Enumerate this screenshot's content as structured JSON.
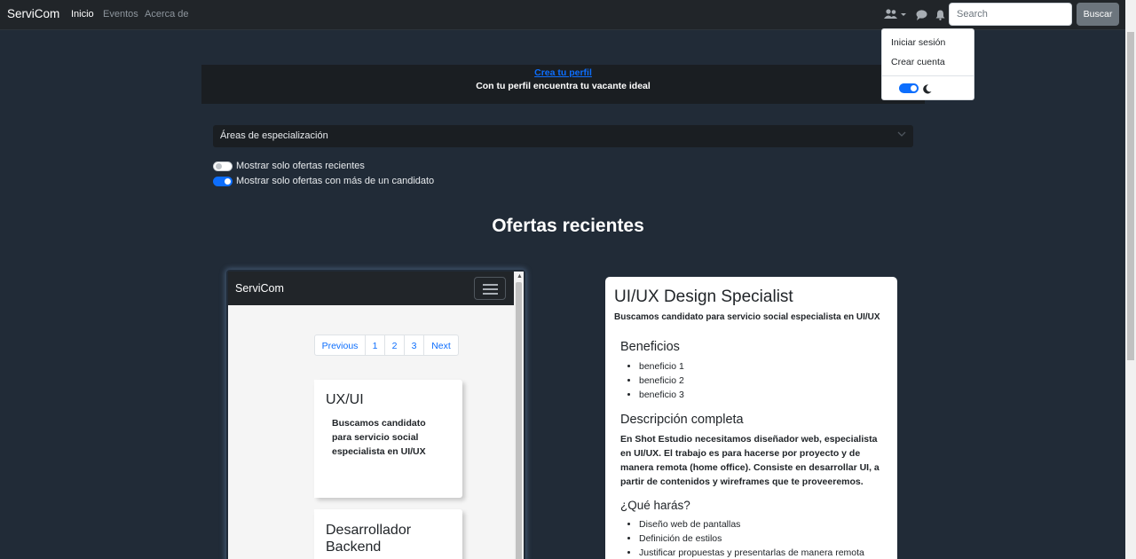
{
  "navbar": {
    "brand": "ServiCom",
    "links": [
      "Inicio",
      "Eventos",
      "Acerca de"
    ],
    "search_placeholder": "Search",
    "search_button": "Buscar"
  },
  "dropdown": {
    "login": "Iniciar sesión",
    "register": "Crear cuenta"
  },
  "banner": {
    "link": "Crea tu perfil",
    "subtitle": "Con tu perfil encuentra tu vacante ideal"
  },
  "areas": {
    "label": "Áreas de especialización"
  },
  "filters": [
    {
      "label": "Mostrar solo ofertas recientes",
      "checked": false
    },
    {
      "label": "Mostrar solo ofertas con más de un candidato",
      "checked": true
    }
  ],
  "section_title": "Ofertas recientes",
  "mockup": {
    "brand": "ServiCom",
    "pagination": [
      "Previous",
      "1",
      "2",
      "3",
      "Next"
    ],
    "cards": [
      {
        "title": "UX/UI",
        "desc": "Buscamos candidato para servicio social especialista en UI/UX"
      },
      {
        "title": "Desarrollador Backend",
        "desc": ""
      }
    ]
  },
  "detail": {
    "title": "UI/UX Design Specialist",
    "subtitle": "Buscamos candidato para servicio social especialista en UI/UX",
    "benefits_heading": "Beneficios",
    "benefits": [
      "beneficio 1",
      "beneficio 2",
      "beneficio 3"
    ],
    "description_heading": "Descripción completa",
    "description": "En Shot Estudio necesitamos diseñador web, especialista en UI/UX. El trabajo es para hacerse por proyecto y de manera remota (home office). Consiste en desarrollar UI, a partir de contenidos y wireframes que te proveeremos.",
    "tasks_heading": "¿Qué harás?",
    "tasks": [
      "Diseño web de pantallas",
      "Definición de estilos",
      "Justificar propuestas y presentarlas de manera remota"
    ]
  },
  "colors": {
    "accent": "#0d6efd",
    "navbar": "#212529",
    "background": "#212b37"
  }
}
